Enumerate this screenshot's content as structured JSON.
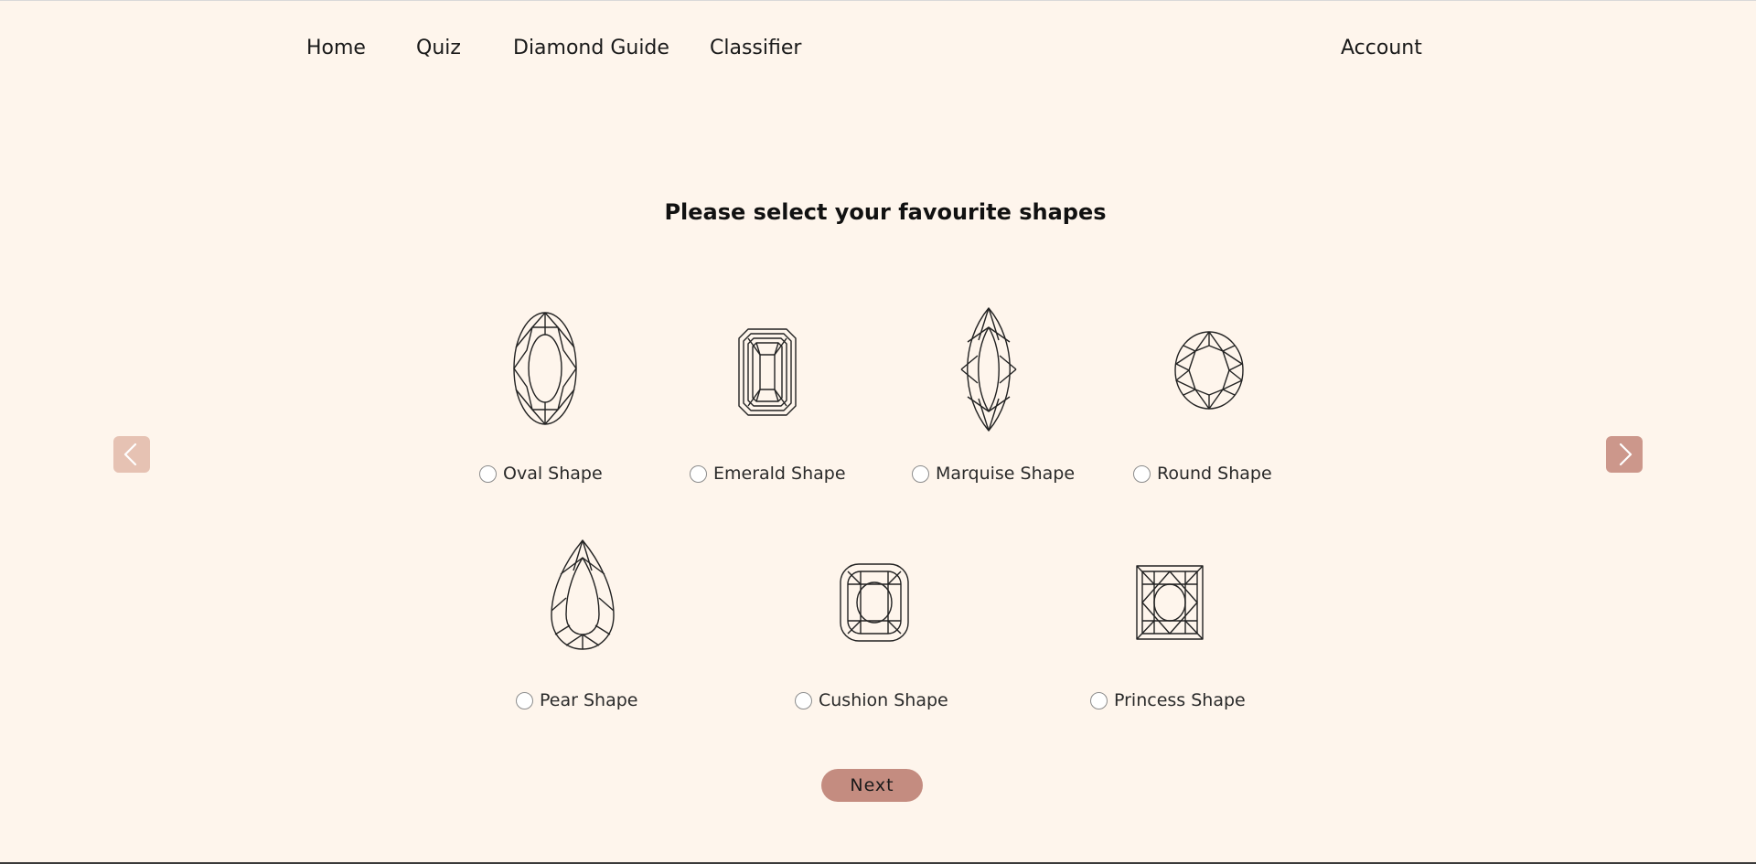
{
  "nav": {
    "home": "Home",
    "quiz": "Quiz",
    "guide": "Diamond Guide",
    "classifier": "Classifier",
    "account": "Account"
  },
  "heading": "Please select your favourite shapes",
  "shapes": {
    "oval": "Oval Shape",
    "emerald": "Emerald Shape",
    "marquise": "Marquise Shape",
    "round": "Round Shape",
    "pear": "Pear Shape",
    "cushion": "Cushion Shape",
    "princess": "Princess Shape"
  },
  "next_label": "Next",
  "icons": {
    "prev": "chevron-left-icon",
    "next": "chevron-right-icon"
  },
  "colors": {
    "background": "#fef5ec",
    "accent": "#c48c80",
    "arrow_disabled": "#e6c2b3",
    "arrow_active": "#cc978b"
  }
}
